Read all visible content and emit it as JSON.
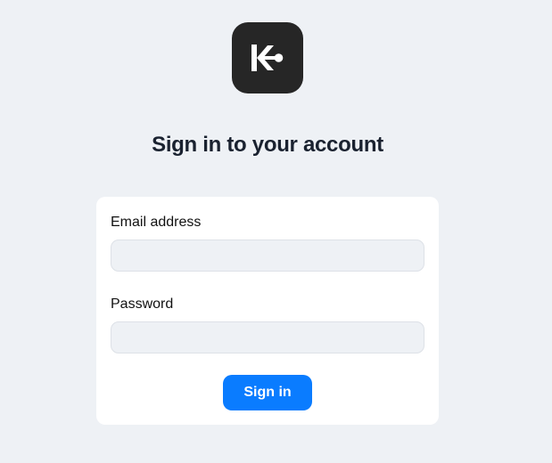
{
  "app": {
    "logo_icon": "k-arrow-logo-icon",
    "logo_bg": "#262626",
    "logo_fg": "#ffffff"
  },
  "header": {
    "title": "Sign in to your account"
  },
  "form": {
    "email_label": "Email address",
    "email_value": "",
    "email_placeholder": "",
    "password_label": "Password",
    "password_value": "",
    "password_placeholder": "",
    "submit_label": "Sign in"
  },
  "colors": {
    "page_bg": "#eef1f5",
    "card_bg": "#ffffff",
    "accent": "#0a7cff",
    "title": "#1a2230"
  }
}
